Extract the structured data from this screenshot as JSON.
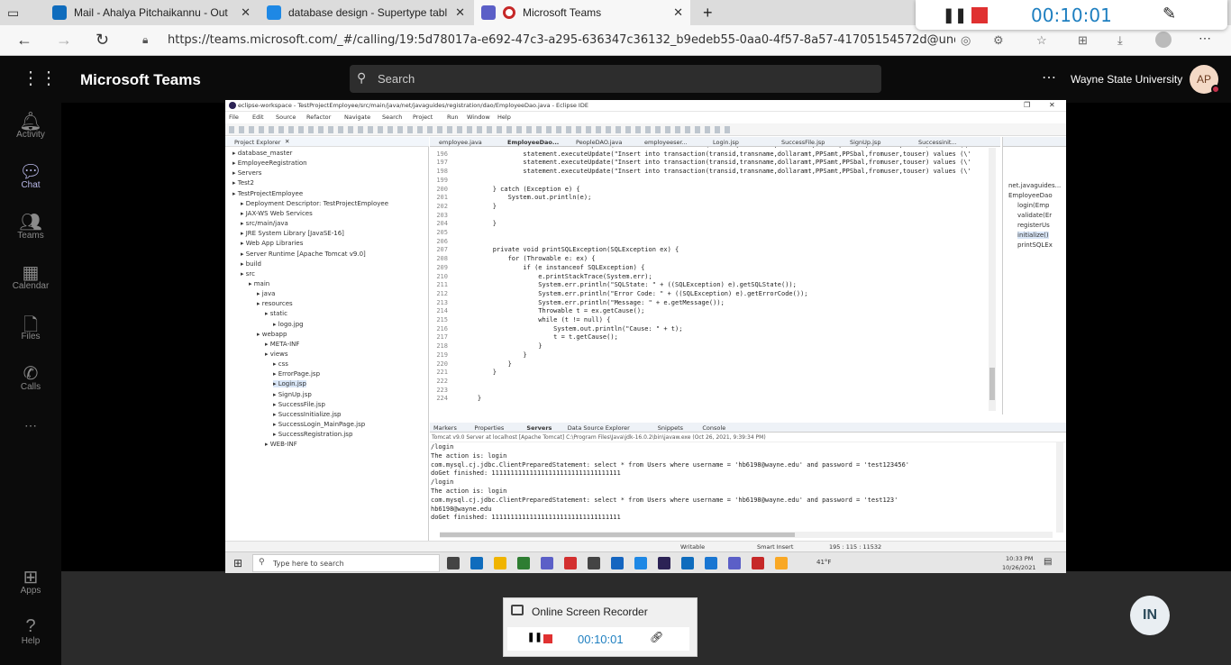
{
  "browser": {
    "tabs": [
      {
        "label": "Mail - Ahalya Pitchaikannu - Out",
        "color": "#0f6cbd"
      },
      {
        "label": "database design - Supertype tabl",
        "color": "#1e88e5"
      },
      {
        "label": "Microsoft Teams",
        "color": "#c62828"
      }
    ],
    "url": "https://teams.microsoft.com/_#/calling/19:5d78017a-e692-47c3-a295-636347c36132_b9edeb55-0aa0-4f57-8a57-41705154572d@unq..."
  },
  "recorder_top": {
    "timer": "00:10:01",
    "accent": "#1e7fc0"
  },
  "teams": {
    "app_title": "Microsoft Teams",
    "search_placeholder": "Search",
    "org": "Wayne State University",
    "avatar_initials": "AP",
    "rail": [
      {
        "label": "Activity",
        "icon": "bell-icon"
      },
      {
        "label": "Chat",
        "icon": "chat-icon"
      },
      {
        "label": "Teams",
        "icon": "teams-icon"
      },
      {
        "label": "Calendar",
        "icon": "calendar-icon"
      },
      {
        "label": "Files",
        "icon": "file-icon"
      },
      {
        "label": "Calls",
        "icon": "phone-icon"
      },
      {
        "label": "Apps",
        "icon": "apps-icon"
      },
      {
        "label": "Help",
        "icon": "help-icon"
      }
    ],
    "participant_initials": "IN"
  },
  "eclipse": {
    "title": "eclipse-workspace - TestProjectEmployee/src/main/java/net/javaguides/registration/dao/EmployeeDao.java - Eclipse IDE",
    "menu": [
      "File",
      "Edit",
      "Source",
      "Refactor",
      "Navigate",
      "Search",
      "Project",
      "Run",
      "Window",
      "Help"
    ],
    "explorer_title": "Project Explorer",
    "tree": [
      "database_master",
      "EmployeeRegistration",
      "Servers",
      "Test2",
      "TestProjectEmployee",
      "Deployment Descriptor: TestProjectEmployee",
      "JAX-WS Web Services",
      "src/main/java",
      "JRE System Library [JavaSE-16]",
      "Web App Libraries",
      "Server Runtime [Apache Tomcat v9.0]",
      "build",
      "src",
      "main",
      "java",
      "resources",
      "static",
      "logo.jpg",
      "webapp",
      "META-INF",
      "views",
      "css",
      "ErrorPage.jsp",
      "Login.jsp",
      "SignUp.jsp",
      "SuccessFile.jsp",
      "SuccessInitialize.jsp",
      "SuccessLogin_MainPage.jsp",
      "SuccessRegistration.jsp",
      "WEB-INF"
    ],
    "editor_tabs": [
      "employee.java",
      "EmployeeDao...",
      "PeopleDAO.java",
      "employeeser...",
      "Login.jsp",
      "SuccessFile.jsp",
      "SignUp.jsp",
      "Successinit..."
    ],
    "code": [
      {
        "n": "195",
        "t": "                statement.executeUpdate(\"Insert into transaction(transid,transname,dollaramt,PPSamt,PPSbal,fromuser,touser) values (\\'"
      },
      {
        "n": "196",
        "t": "                statement.executeUpdate(\"Insert into transaction(transid,transname,dollaramt,PPSamt,PPSbal,fromuser,touser) values (\\'"
      },
      {
        "n": "197",
        "t": "                statement.executeUpdate(\"Insert into transaction(transid,transname,dollaramt,PPSamt,PPSbal,fromuser,touser) values (\\'"
      },
      {
        "n": "198",
        "t": "                statement.executeUpdate(\"Insert into transaction(transid,transname,dollaramt,PPSamt,PPSbal,fromuser,touser) values (\\'"
      },
      {
        "n": "199",
        "t": ""
      },
      {
        "n": "200",
        "t": "        } catch (Exception e) {"
      },
      {
        "n": "201",
        "t": "            System.out.println(e);"
      },
      {
        "n": "202",
        "t": "        }"
      },
      {
        "n": "203",
        "t": ""
      },
      {
        "n": "204",
        "t": "        }"
      },
      {
        "n": "205",
        "t": ""
      },
      {
        "n": "206",
        "t": ""
      },
      {
        "n": "207",
        "t": "        private void printSQLException(SQLException ex) {"
      },
      {
        "n": "208",
        "t": "            for (Throwable e: ex) {"
      },
      {
        "n": "209",
        "t": "                if (e instanceof SQLException) {"
      },
      {
        "n": "210",
        "t": "                    e.printStackTrace(System.err);"
      },
      {
        "n": "211",
        "t": "                    System.err.println(\"SQLState: \" + ((SQLException) e).getSQLState());"
      },
      {
        "n": "212",
        "t": "                    System.err.println(\"Error Code: \" + ((SQLException) e).getErrorCode());"
      },
      {
        "n": "213",
        "t": "                    System.err.println(\"Message: \" + e.getMessage());"
      },
      {
        "n": "214",
        "t": "                    Throwable t = ex.getCause();"
      },
      {
        "n": "215",
        "t": "                    while (t != null) {"
      },
      {
        "n": "216",
        "t": "                        System.out.println(\"Cause: \" + t);"
      },
      {
        "n": "217",
        "t": "                        t = t.getCause();"
      },
      {
        "n": "218",
        "t": "                    }"
      },
      {
        "n": "219",
        "t": "                }"
      },
      {
        "n": "220",
        "t": "            }"
      },
      {
        "n": "221",
        "t": "        }"
      },
      {
        "n": "222",
        "t": ""
      },
      {
        "n": "223",
        "t": ""
      },
      {
        "n": "224",
        "t": "    }"
      }
    ],
    "outline": [
      "net.javaguides...",
      "EmployeeDao",
      "login(Emp",
      "validate(Er",
      "registerUs",
      "initialize()",
      "printSQLEx"
    ],
    "bottom_tabs": [
      "Markers",
      "Properties",
      "Servers",
      "Data Source Explorer",
      "Snippets",
      "Console"
    ],
    "console_header": "Tomcat v9.0 Server at localhost [Apache Tomcat] C:\\Program Files\\Java\\jdk-16.0.2\\bin\\javaw.exe (Oct 26, 2021, 9:39:34 PM)",
    "console": [
      "/login",
      "The action is: login",
      "com.mysql.cj.jdbc.ClientPreparedStatement: select * from Users where username = 'hb6198@wayne.edu' and password = 'test123456'",
      "doGet finished: 1111111111111111111111111111111111",
      "/login",
      "The action is: login",
      "com.mysql.cj.jdbc.ClientPreparedStatement: select * from Users where username = 'hb6198@wayne.edu' and password = 'test123'",
      "hb6198@wayne.edu",
      "doGet finished: 1111111111111111111111111111111111"
    ],
    "status": {
      "mode": "Writable",
      "insert": "Smart Insert",
      "pos": "195 : 115 : 11532"
    },
    "taskbar": {
      "search_placeholder": "Type here to search",
      "weather": "41°F",
      "time": "10:33 PM",
      "date": "10/26/2021"
    }
  },
  "recorder_bottom": {
    "title": "Online Screen Recorder",
    "timer": "00:10:01"
  }
}
